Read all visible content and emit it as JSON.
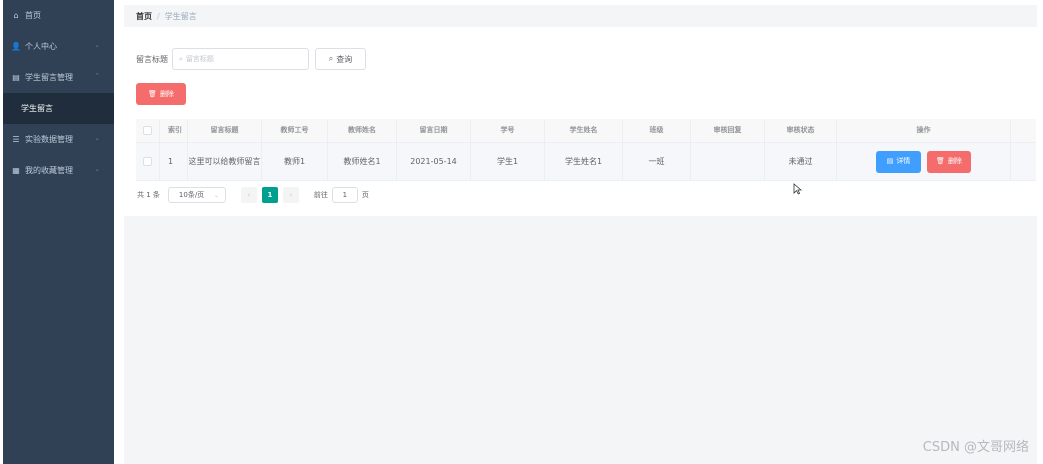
{
  "sidebar": {
    "items": [
      {
        "icon": "home-icon",
        "label": "首页"
      },
      {
        "icon": "user-icon",
        "label": "个人中心"
      },
      {
        "icon": "message-icon",
        "label": "学生留言管理"
      },
      {
        "label": "学生留言"
      },
      {
        "icon": "data-icon",
        "label": "实验数据管理"
      },
      {
        "icon": "grid-icon",
        "label": "我的收藏管理"
      }
    ]
  },
  "breadcrumb": {
    "home": "首页",
    "separator": "/",
    "current": "学生留言"
  },
  "search": {
    "label": "留言标题",
    "placeholder": "留言标题",
    "button": "查询"
  },
  "toolbar": {
    "delete_label": "删除"
  },
  "table": {
    "headers": [
      "索引",
      "留言标题",
      "教师工号",
      "教师姓名",
      "留言日期",
      "学号",
      "学生姓名",
      "班级",
      "审核回复",
      "审核状态",
      "操作"
    ],
    "rows": [
      {
        "index": "1",
        "title": "这里可以给教师留言",
        "teacher_id": "教师1",
        "teacher_name": "教师姓名1",
        "date": "2021-05-14",
        "student_id": "学生1",
        "student_name": "学生姓名1",
        "class": "一班",
        "review_reply": "",
        "review_status": "未通过",
        "detail_label": "详情",
        "delete_label": "删除"
      }
    ]
  },
  "pagination": {
    "total": "共 1 条",
    "page_size": "10条/页",
    "current_page": "1",
    "goto_label": "前往",
    "goto_value": "1",
    "page_suffix": "页"
  },
  "watermark": "CSDN @文哥网络",
  "colors": {
    "sidebar_bg": "#304156",
    "primary": "#409eff",
    "danger": "#f56c6c",
    "active_page": "#00a091"
  }
}
